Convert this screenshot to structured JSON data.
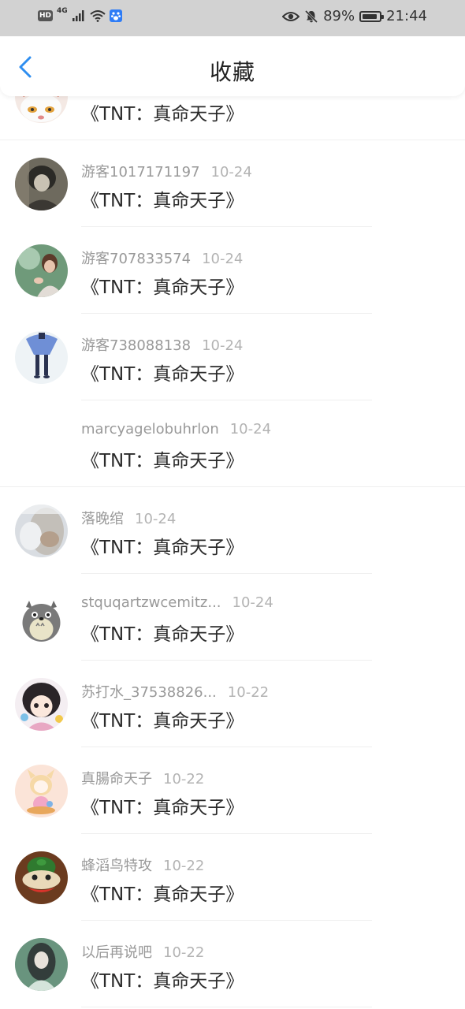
{
  "status_bar": {
    "hd": "HD",
    "network": "4G",
    "battery": "89%",
    "time": "21:44"
  },
  "header": {
    "title": "收藏"
  },
  "items": [
    {
      "nick": "",
      "date": "",
      "comic": "《TNT：真命天子》"
    },
    {
      "nick": "游客1017171197",
      "date": "10-24",
      "comic": "《TNT：真命天子》"
    },
    {
      "nick": "游客707833574",
      "date": "10-24",
      "comic": "《TNT：真命天子》"
    },
    {
      "nick": "游客738088138",
      "date": "10-24",
      "comic": "《TNT：真命天子》"
    },
    {
      "nick": "marcyagelobuhrlon",
      "date": "10-24",
      "comic": "《TNT：真命天子》"
    },
    {
      "nick": "落晚绾",
      "date": "10-24",
      "comic": "《TNT：真命天子》"
    },
    {
      "nick": "stquqartzwcemitz...",
      "date": "10-24",
      "comic": "《TNT：真命天子》"
    },
    {
      "nick": "苏打水_37538826...",
      "date": "10-22",
      "comic": "《TNT：真命天子》"
    },
    {
      "nick": "真腸命天子",
      "date": "10-22",
      "comic": "《TNT：真命天子》"
    },
    {
      "nick": "蜂滔鸟特攻",
      "date": "10-22",
      "comic": "《TNT：真命天子》"
    },
    {
      "nick": "以后再说吧",
      "date": "10-22",
      "comic": "《TNT：真命天子》"
    }
  ]
}
